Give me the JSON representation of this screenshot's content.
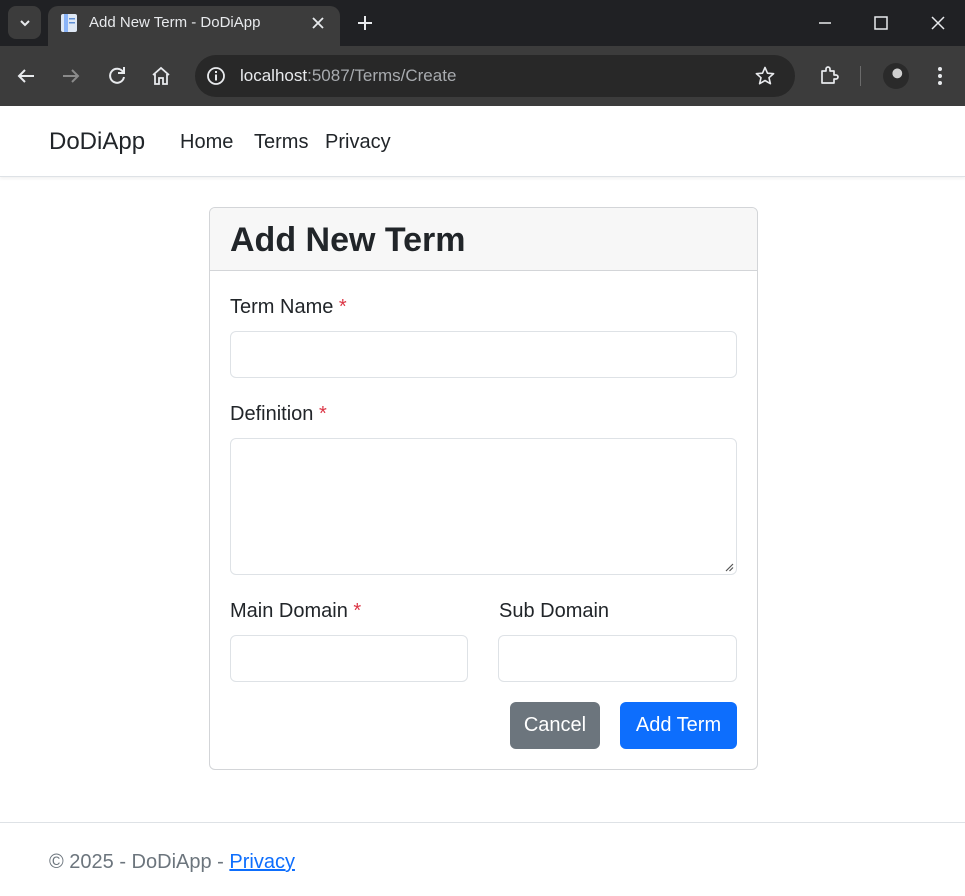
{
  "browser": {
    "tab": {
      "title": "Add New Term - DoDiApp",
      "favicon": "document-icon"
    },
    "address": {
      "host": "localhost",
      "path": ":5087/Terms/Create"
    },
    "colors": {
      "tabbar": "#202124",
      "toolbar": "#3c3c3c"
    }
  },
  "navbar": {
    "brand": "DoDiApp",
    "links": [
      {
        "label": "Home"
      },
      {
        "label": "Terms"
      },
      {
        "label": "Privacy"
      }
    ]
  },
  "form": {
    "title": "Add New Term",
    "required_marker": "*",
    "term_name": {
      "label": "Term Name",
      "value": ""
    },
    "definition": {
      "label": "Definition",
      "value": ""
    },
    "main_domain": {
      "label": "Main Domain",
      "value": ""
    },
    "sub_domain": {
      "label": "Sub Domain",
      "value": ""
    },
    "cancel_label": "Cancel",
    "submit_label": "Add Term"
  },
  "footer": {
    "text": "© 2025 - DoDiApp - ",
    "privacy_link": "Privacy"
  },
  "colors": {
    "primary": "#0d6efd",
    "secondary": "#6c757d",
    "required": "#dc3545"
  }
}
